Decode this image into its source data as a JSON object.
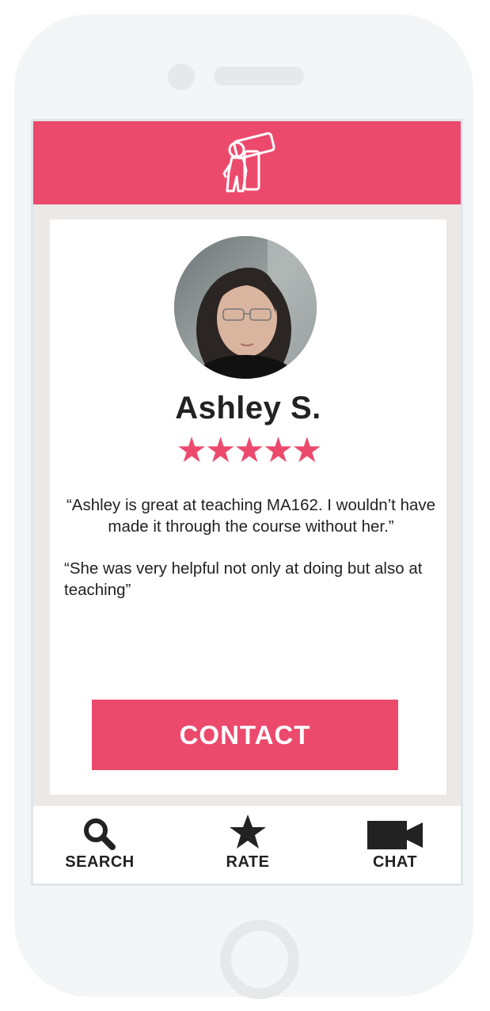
{
  "app": {
    "logo_icon": "tutor-person-holding-book-icon",
    "accent_color": "#ec4a6d"
  },
  "profile": {
    "name": "Ashley S.",
    "avatar_icon": "profile-photo",
    "rating_stars": "★★★★★",
    "rating_value": 5,
    "rating_max": 5
  },
  "reviews": [
    {
      "text": "“Ashley is great at teaching MA162. I wouldn’t have made it through the course without her.”"
    },
    {
      "text": "“She was very helpful not only at doing but also at teaching”"
    }
  ],
  "actions": {
    "contact_label": "CONTACT"
  },
  "tabs": [
    {
      "label": "SEARCH",
      "icon": "search-icon"
    },
    {
      "label": "RATE",
      "icon": "star-icon"
    },
    {
      "label": "CHAT",
      "icon": "video-camera-icon"
    }
  ]
}
